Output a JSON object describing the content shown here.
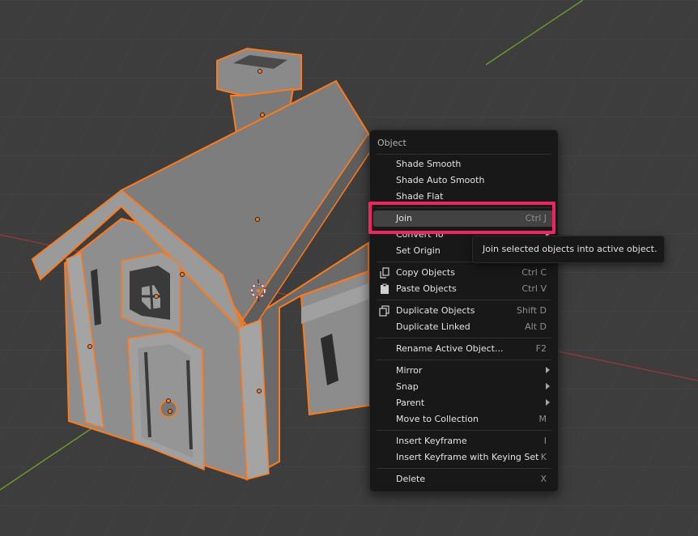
{
  "menu": {
    "title": "Object",
    "items": [
      {
        "label": "Shade Smooth",
        "shortcut": "",
        "submenu": false,
        "icon": ""
      },
      {
        "label": "Shade Auto Smooth",
        "shortcut": "",
        "submenu": false,
        "icon": ""
      },
      {
        "label": "Shade Flat",
        "shortcut": "",
        "submenu": false,
        "icon": ""
      },
      {
        "label": "Join",
        "shortcut": "Ctrl J",
        "submenu": false,
        "icon": "",
        "active": true
      },
      {
        "label": "Convert To",
        "shortcut": "",
        "submenu": true,
        "icon": ""
      },
      {
        "label": "Set Origin",
        "shortcut": "",
        "submenu": true,
        "icon": ""
      },
      {
        "label": "Copy Objects",
        "shortcut": "Ctrl C",
        "submenu": false,
        "icon": "copy-icon"
      },
      {
        "label": "Paste Objects",
        "shortcut": "Ctrl V",
        "submenu": false,
        "icon": "paste-icon"
      },
      {
        "label": "Duplicate Objects",
        "shortcut": "Shift D",
        "submenu": false,
        "icon": "duplicate-icon"
      },
      {
        "label": "Duplicate Linked",
        "shortcut": "Alt D",
        "submenu": false,
        "icon": ""
      },
      {
        "label": "Rename Active Object...",
        "shortcut": "F2",
        "submenu": false,
        "icon": ""
      },
      {
        "label": "Mirror",
        "shortcut": "",
        "submenu": true,
        "icon": ""
      },
      {
        "label": "Snap",
        "shortcut": "",
        "submenu": true,
        "icon": ""
      },
      {
        "label": "Parent",
        "shortcut": "",
        "submenu": true,
        "icon": ""
      },
      {
        "label": "Move to Collection",
        "shortcut": "M",
        "submenu": false,
        "icon": ""
      },
      {
        "label": "Insert Keyframe",
        "shortcut": "I",
        "submenu": false,
        "icon": ""
      },
      {
        "label": "Insert Keyframe with Keying Set",
        "shortcut": "K",
        "submenu": false,
        "icon": ""
      },
      {
        "label": "Delete",
        "shortcut": "X",
        "submenu": false,
        "icon": ""
      }
    ]
  },
  "tooltip": {
    "text": "Join selected objects into active object."
  },
  "colors": {
    "viewport_bg": "#3d3d3d",
    "menu_bg": "#181818",
    "selection_outline": "#ff7a1a",
    "highlight_box": "#f0245f",
    "x_axis": "#9a3a3a",
    "y_axis": "#6d9a2c"
  }
}
